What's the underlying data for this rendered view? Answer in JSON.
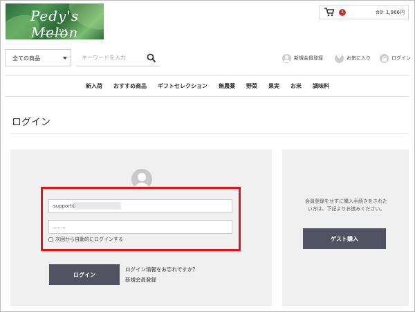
{
  "logo": {
    "title": "Pedy's Melon",
    "subtitle": "since 2016"
  },
  "cart": {
    "count": "1",
    "total_label": "合計",
    "total": "1,966円",
    "icon": "cart-icon"
  },
  "search": {
    "category": "全ての商品",
    "placeholder": "キーワードを入力",
    "icon": "search-icon"
  },
  "header_links": [
    {
      "label": "新規会員登録",
      "icon": "user-icon"
    },
    {
      "label": "お気に入り",
      "icon": "heart-icon"
    },
    {
      "label": "ログイン",
      "icon": "lock-icon"
    }
  ],
  "nav": [
    "新入荷",
    "おすすめ商品",
    "ギフトセレクション",
    "無農薬",
    "野菜",
    "果実",
    "お米",
    "調味料"
  ],
  "page": {
    "title": "ログイン"
  },
  "login": {
    "email_value": "support@",
    "password_value": "........",
    "remember_label": "次回から自動的にログインする",
    "button_label": "ログイン",
    "forgot_link": "ログイン情報をお忘れですか？",
    "register_link": "新規会員登録",
    "highlight_color": "#e0141c"
  },
  "guest": {
    "text": "会員登録をせずに購入手続きをされたい方は、下記よりお進みください。",
    "button_label": "ゲスト購入"
  },
  "colors": {
    "button": "#525263",
    "panel": "#f0f0f0",
    "badge": "#c0392b"
  }
}
